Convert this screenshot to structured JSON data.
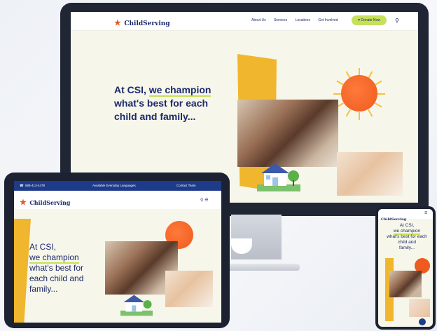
{
  "brand": {
    "logo_text": "ChildServing",
    "logo_mark": "★"
  },
  "desktop": {
    "nav": {
      "items": [
        "About Us",
        "Services",
        "Locations",
        "Get Involved"
      ],
      "cta": "Donate Now"
    },
    "headline": {
      "line1": "At CSI,",
      "highlight": "we champion",
      "line2": "what's best for each",
      "line3": "child and family..."
    }
  },
  "tablet": {
    "topbar": {
      "phone": "888-413-4478",
      "language": "Available Everyday Languages",
      "contact": "Contact Team"
    },
    "headline": {
      "line1": "At CSI,",
      "highlight": "we champion",
      "line2": "what's best for",
      "line3": "each child and",
      "line4": "family..."
    }
  },
  "phone": {
    "headline": {
      "line1": "At CSI,",
      "highlight": "we champion",
      "line2": "what's best for each child and",
      "line3": "family..."
    }
  },
  "colors": {
    "navy": "#1b2a6b",
    "accent_green": "#c6e05a",
    "accent_yellow": "#f0b62d",
    "sun_orange": "#ef5a1f",
    "topbar_blue": "#1e3a8a"
  },
  "icons": [
    "search-icon",
    "menu-icon",
    "phone-icon",
    "chat-icon",
    "heart-icon"
  ]
}
